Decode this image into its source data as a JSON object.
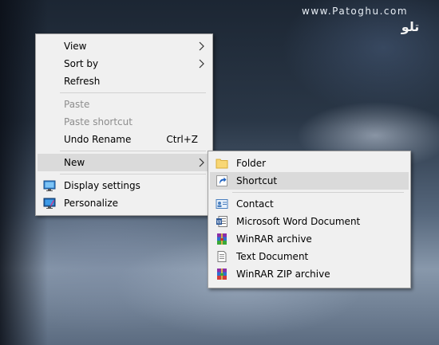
{
  "watermark": {
    "text": "www.Patoghu.com",
    "logo_text": "تلو"
  },
  "context_menu": {
    "items": [
      {
        "label": "View",
        "has_submenu": true
      },
      {
        "label": "Sort by",
        "has_submenu": true
      },
      {
        "label": "Refresh"
      },
      {
        "label": "Paste",
        "disabled": true
      },
      {
        "label": "Paste shortcut",
        "disabled": true
      },
      {
        "label": "Undo Rename",
        "shortcut": "Ctrl+Z"
      },
      {
        "label": "New",
        "has_submenu": true,
        "highlighted": true
      },
      {
        "label": "Display settings",
        "icon": "display-settings-icon"
      },
      {
        "label": "Personalize",
        "icon": "personalize-icon"
      }
    ]
  },
  "new_submenu": {
    "items": [
      {
        "label": "Folder",
        "icon": "folder-icon"
      },
      {
        "label": "Shortcut",
        "icon": "shortcut-icon",
        "highlighted": true
      },
      {
        "label": "Contact",
        "icon": "contact-icon"
      },
      {
        "label": "Microsoft Word Document",
        "icon": "word-document-icon"
      },
      {
        "label": "WinRAR archive",
        "icon": "winrar-archive-icon"
      },
      {
        "label": "Text Document",
        "icon": "text-document-icon"
      },
      {
        "label": "WinRAR ZIP archive",
        "icon": "winrar-zip-icon"
      }
    ]
  },
  "colors": {
    "menu_background": "#f0f0f0",
    "highlight": "#dadada",
    "disabled_text": "#8d8d8d",
    "separator": "#d2d2d2"
  }
}
